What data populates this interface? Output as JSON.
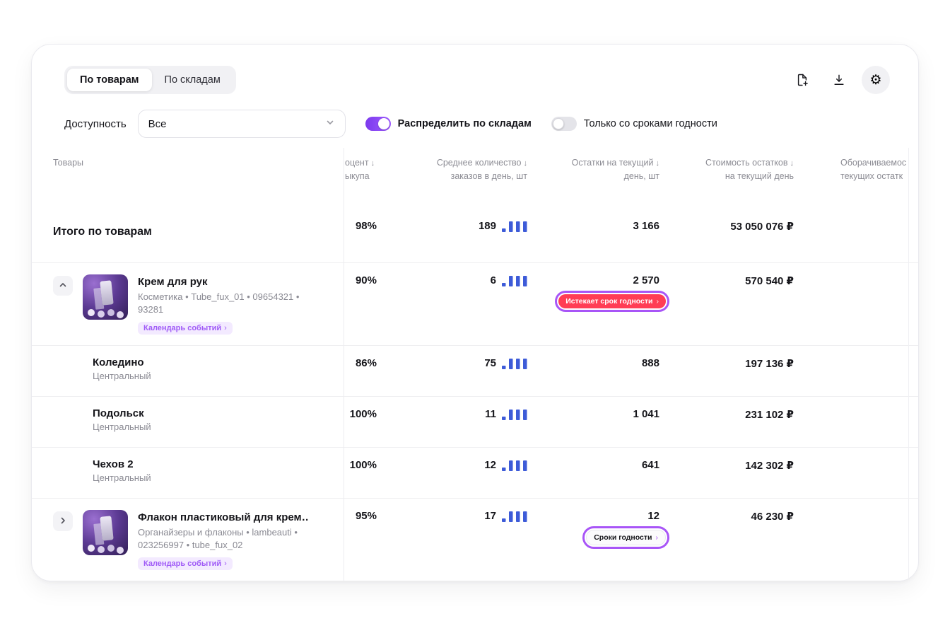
{
  "tabs": {
    "items": [
      {
        "label": "По товарам",
        "active": true
      },
      {
        "label": "По складам",
        "active": false
      }
    ]
  },
  "toolbar": {
    "buttons": [
      {
        "name": "create-report",
        "icon": "file-plus-icon"
      },
      {
        "name": "download",
        "icon": "download-icon"
      },
      {
        "name": "settings",
        "icon": "gear-icon"
      }
    ]
  },
  "filters": {
    "availability_label": "Доступность",
    "availability_value": "Все",
    "toggle_distribute": {
      "label": "Распределить по складам",
      "on": true
    },
    "toggle_expiry": {
      "label": "Только со сроками годности",
      "on": false
    }
  },
  "misc": {
    "chevron": "›",
    "sort_arrow": "↓",
    "gear_glyph": "⚙"
  },
  "colors": {
    "accent_purple": "#8B46F6",
    "highlight_ring": "#A855F7",
    "danger_badge": "#FF3D55",
    "bars_blue": "#3D5BD8",
    "calendar_badge_bg": "#F3EAFF",
    "calendar_badge_text": "#A05BF7"
  },
  "table": {
    "columns": [
      {
        "label1": "Товары",
        "label2": "",
        "sorted": false
      },
      {
        "label1": "оцент",
        "label2": "ыкупа",
        "sorted": true
      },
      {
        "label1": "Среднее количество",
        "label2": "заказов в день, шт",
        "sorted": true
      },
      {
        "label1": "Остатки на текущий",
        "label2": "день, шт",
        "sorted": true
      },
      {
        "label1": "Стоимость остатков",
        "label2": "на текущий день",
        "sorted": true
      },
      {
        "label1": "Оборачиваемос",
        "label2": "текущих остатк",
        "sorted": false
      }
    ],
    "summary": {
      "label": "Итого по товарам",
      "buyout_percent": "98%",
      "avg_orders": "189",
      "stock": "3 166",
      "stock_value": "53 050 076 ₽"
    },
    "rows": [
      {
        "type": "product",
        "expanded": true,
        "title": "Крем для рук",
        "subtitle": "Косметика • Tube_fux_01 • 09654321 • 93281",
        "calendar_badge": "Календарь событий",
        "buyout_percent": "90%",
        "avg_orders": "6",
        "stock": "2 570",
        "stock_badge": {
          "label": "Истекает срок годности",
          "variant": "danger",
          "highlighted": true
        },
        "stock_value": "570 540 ₽"
      },
      {
        "type": "warehouse",
        "name": "Коледино",
        "region": "Центральный",
        "buyout_percent": "86%",
        "avg_orders": "75",
        "stock": "888",
        "stock_value": "197 136 ₽"
      },
      {
        "type": "warehouse",
        "name": "Подольск",
        "region": "Центральный",
        "buyout_percent": "100%",
        "avg_orders": "11",
        "stock": "1 041",
        "stock_value": "231 102 ₽"
      },
      {
        "type": "warehouse",
        "name": "Чехов 2",
        "region": "Центральный",
        "buyout_percent": "100%",
        "avg_orders": "12",
        "stock": "641",
        "stock_value": "142 302 ₽"
      },
      {
        "type": "product",
        "expanded": false,
        "title": "Флакон пластиковый для крем…",
        "subtitle": "Органайзеры и флаконы • lambeauti • 023256997 • tube_fux_02",
        "calendar_badge": "Календарь событий",
        "buyout_percent": "95%",
        "avg_orders": "17",
        "stock": "12",
        "stock_badge": {
          "label": "Сроки годности",
          "variant": "light",
          "highlighted": true
        },
        "stock_value": "46 230 ₽"
      }
    ]
  }
}
